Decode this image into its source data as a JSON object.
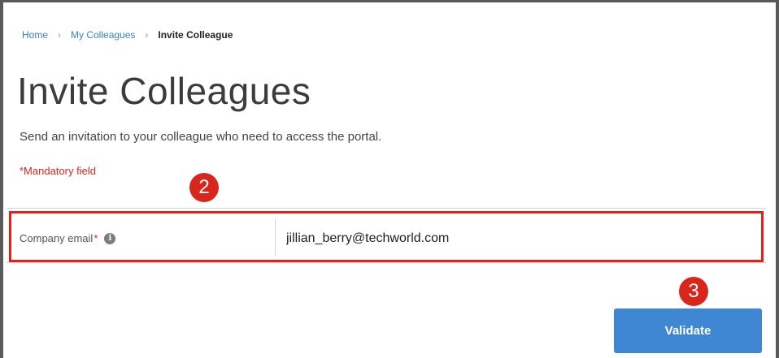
{
  "breadcrumb": {
    "items": [
      {
        "label": "Home"
      },
      {
        "label": "My Colleagues"
      },
      {
        "label": "Invite Colleague"
      }
    ],
    "separator": "›"
  },
  "page": {
    "title": "Invite Colleagues",
    "subtitle": "Send an invitation to your colleague who need to access the portal.",
    "mandatory_note": "*Mandatory field"
  },
  "form": {
    "email_label": "Company email",
    "required_marker": "*",
    "info_icon": "info-icon",
    "info_glyph": "i",
    "email_value": "jillian_berry@techworld.com"
  },
  "actions": {
    "validate_label": "Validate"
  },
  "annotations": {
    "step_2": "2",
    "step_3": "3",
    "highlight_color": "#e0221b"
  },
  "colors": {
    "accent": "#3f87d3",
    "link": "#3a7dc9",
    "required": "#d9261c"
  }
}
